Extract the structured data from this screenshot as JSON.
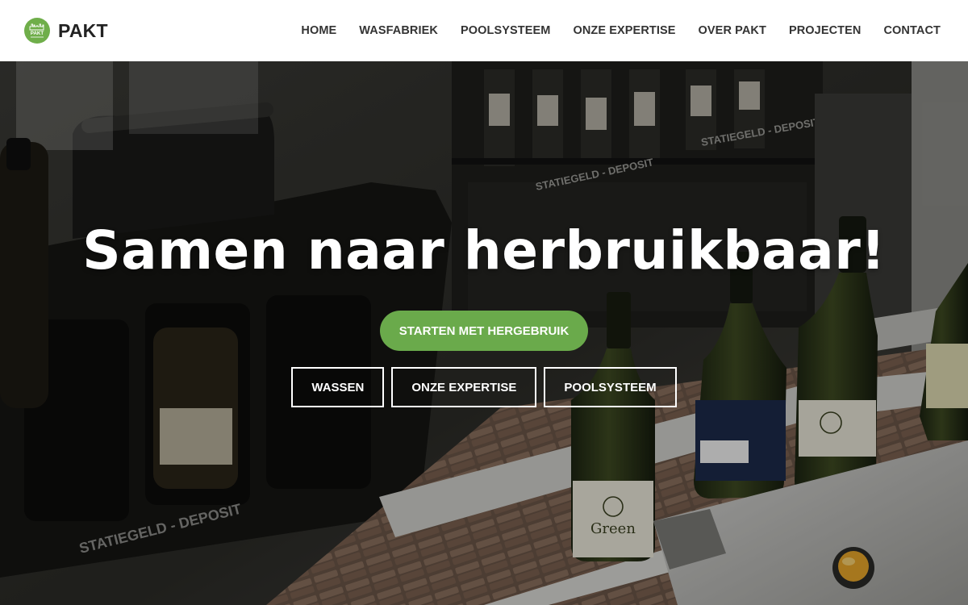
{
  "brand": {
    "name": "PAKT",
    "logo_text": "PAKT",
    "logo_color": "#6fae4a"
  },
  "nav": {
    "items": [
      {
        "label": "HOME"
      },
      {
        "label": "WASFABRIEK"
      },
      {
        "label": "POOLSYSTEEM"
      },
      {
        "label": "ONZE EXPERTISE"
      },
      {
        "label": "OVER PAKT"
      },
      {
        "label": "PROJECTEN"
      },
      {
        "label": "CONTACT"
      }
    ]
  },
  "hero": {
    "title": "Samen naar herbruikbaar!",
    "primary_cta": "STARTEN MET HERGEBRUIK",
    "primary_cta_color": "#6aaa4b",
    "secondary_buttons": [
      {
        "label": "WASSEN"
      },
      {
        "label": "ONZE EXPERTISE"
      },
      {
        "label": "POOLSYSTEEM"
      }
    ],
    "background": {
      "crate_text": "STATIEGELD - DEPOSIT",
      "bottle_label": "Green"
    }
  }
}
